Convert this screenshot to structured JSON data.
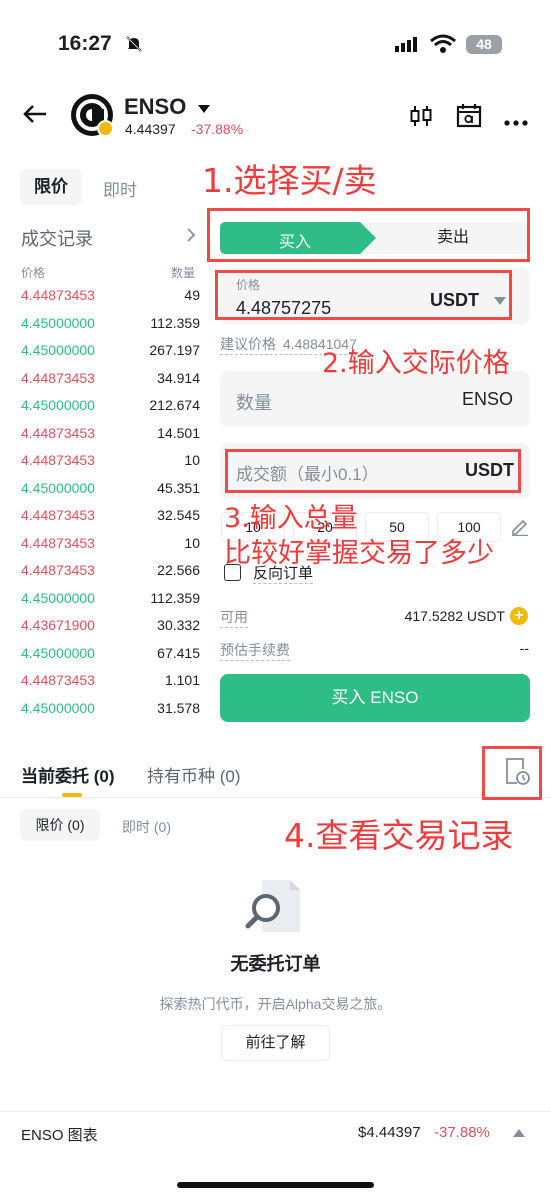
{
  "status_bar": {
    "time": "16:27",
    "battery": "48"
  },
  "header": {
    "symbol": "ENSO",
    "price": "4.44397",
    "change": "-37.88%"
  },
  "order_type_tabs": [
    "限价",
    "即时"
  ],
  "trades": {
    "title": "成交记录",
    "col_price": "价格",
    "col_qty": "数量",
    "rows": [
      {
        "price": "4.44873453",
        "qty": "49",
        "side": "sell"
      },
      {
        "price": "4.45000000",
        "qty": "112.359",
        "side": "buy"
      },
      {
        "price": "4.45000000",
        "qty": "267.197",
        "side": "buy"
      },
      {
        "price": "4.44873453",
        "qty": "34.914",
        "side": "sell"
      },
      {
        "price": "4.45000000",
        "qty": "212.674",
        "side": "buy"
      },
      {
        "price": "4.44873453",
        "qty": "14.501",
        "side": "sell"
      },
      {
        "price": "4.44873453",
        "qty": "10",
        "side": "sell"
      },
      {
        "price": "4.45000000",
        "qty": "45.351",
        "side": "buy"
      },
      {
        "price": "4.44873453",
        "qty": "32.545",
        "side": "sell"
      },
      {
        "price": "4.44873453",
        "qty": "10",
        "side": "sell"
      },
      {
        "price": "4.44873453",
        "qty": "22.566",
        "side": "sell"
      },
      {
        "price": "4.45000000",
        "qty": "112.359",
        "side": "buy"
      },
      {
        "price": "4.43671900",
        "qty": "30.332",
        "side": "sell"
      },
      {
        "price": "4.45000000",
        "qty": "67.415",
        "side": "buy"
      },
      {
        "price": "4.44873453",
        "qty": "1.101",
        "side": "sell"
      },
      {
        "price": "4.45000000",
        "qty": "31.578",
        "side": "buy"
      }
    ]
  },
  "form": {
    "buy_label": "买入",
    "sell_label": "卖出",
    "price_label": "价格",
    "price_value": "4.48757275",
    "price_unit": "USDT",
    "suggested_label": "建议价格",
    "suggested_value": "4.48841047",
    "qty_placeholder": "数量",
    "qty_unit": "ENSO",
    "amount_placeholder": "成交额（最小0.1）",
    "amount_unit": "USDT",
    "quick_amounts": [
      "10",
      "20",
      "50",
      "100"
    ],
    "reverse_label": "反向订单",
    "available_label": "可用",
    "available_value": "417.5282 USDT",
    "fee_label": "预估手续费",
    "fee_value": "--",
    "submit_label": "买入 ENSO"
  },
  "annotations": {
    "a1": "1.选择买/卖",
    "a2": "2.输入交际价格",
    "a3_line1": "3.输入总量",
    "a3_line2": "比较好掌握交易了多少",
    "a4": "4.查看交易记录"
  },
  "orders": {
    "tab_current": "当前委托 (0)",
    "tab_holdings": "持有币种 (0)",
    "sub_limit": "限价 (0)",
    "sub_instant": "即时 (0)",
    "empty_title": "无委托订单",
    "empty_desc": "探索热门代币，开启Alpha交易之旅。",
    "learn_button": "前往了解"
  },
  "footer": {
    "chart_label": "ENSO 图表",
    "price": "$4.44397",
    "change": "-37.88%"
  },
  "colors": {
    "buy": "#2ebd85",
    "sell": "#e0505f",
    "annotation": "#ef3b3b",
    "coin_badge": "#f0b90b"
  }
}
